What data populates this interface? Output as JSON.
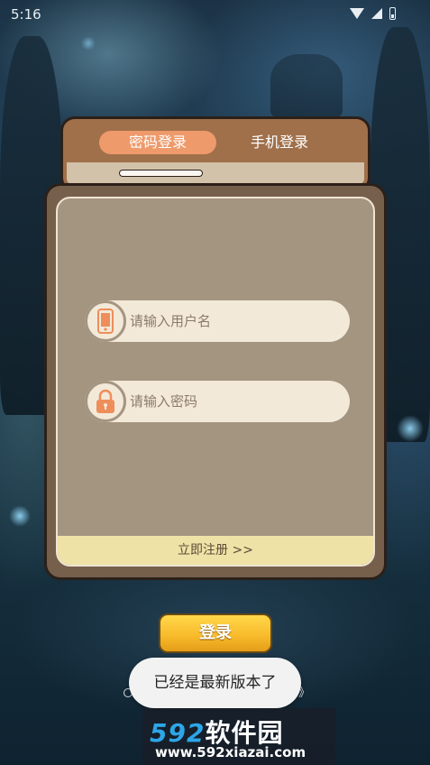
{
  "status_bar": {
    "time": "5:16",
    "icons": [
      "wifi-icon",
      "signal-icon",
      "battery-icon"
    ]
  },
  "login_tabs": {
    "tabs": [
      {
        "label": "密码登录",
        "active": true
      },
      {
        "label": "手机登录",
        "active": false
      }
    ]
  },
  "form": {
    "username": {
      "placeholder": "请输入用户名",
      "value": "",
      "icon": "phone-icon"
    },
    "password": {
      "placeholder": "请输入密码",
      "value": "",
      "icon": "lock-icon"
    },
    "register_label": "立即注册 >>"
  },
  "login_button": {
    "label": "登录"
  },
  "agreement": {
    "tail_text": "》"
  },
  "toast": {
    "message": "已经是最新版本了"
  },
  "watermark": {
    "logo_number": "592",
    "logo_text": "软件园",
    "url": "www.592xiazai.com"
  },
  "colors": {
    "tab_card": "#a0704b",
    "active_tab": "#ee9a6b",
    "main_card": "#76604c",
    "inner_panel": "#a49581",
    "field_bg": "#f3e9d9",
    "icon_orange": "#ee8e5a",
    "register_bar": "#efe2a6",
    "login_button": "#f7b92a"
  }
}
